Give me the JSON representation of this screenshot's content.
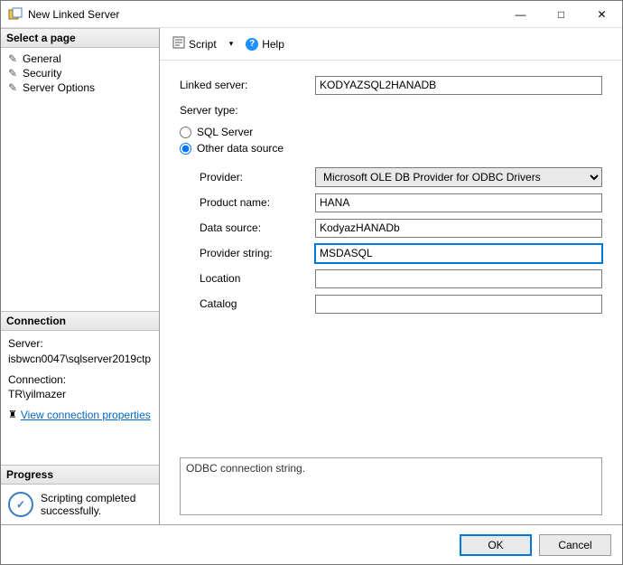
{
  "window": {
    "title": "New Linked Server"
  },
  "winbuttons": {
    "min": "—",
    "max": "□",
    "close": "✕"
  },
  "sidebar": {
    "select_page_hdr": "Select a page",
    "pages": [
      {
        "label": "General"
      },
      {
        "label": "Security"
      },
      {
        "label": "Server Options"
      }
    ],
    "connection_hdr": "Connection",
    "server_lbl": "Server:",
    "server_val": "isbwcn0047\\sqlserver2019ctp",
    "conn_lbl": "Connection:",
    "conn_val": "TR\\yilmazer",
    "view_conn_link": "View connection properties",
    "progress_hdr": "Progress",
    "progress_msg": "Scripting completed successfully."
  },
  "toolbar": {
    "script_label": "Script",
    "script_arrow": "▾",
    "help_label": "Help"
  },
  "form": {
    "linked_server_lbl": "Linked server:",
    "linked_server_val": "KODYAZSQL2HANADB",
    "server_type_lbl": "Server type:",
    "radio_sql": "SQL Server",
    "radio_other": "Other data source",
    "provider_lbl": "Provider:",
    "provider_val": "Microsoft OLE DB Provider for ODBC Drivers",
    "product_name_lbl": "Product name:",
    "product_name_val": "HANA",
    "data_source_lbl": "Data source:",
    "data_source_val": "KodyazHANADb",
    "provider_string_lbl": "Provider string:",
    "provider_string_val": "MSDASQL",
    "location_lbl": "Location",
    "location_val": "",
    "catalog_lbl": "Catalog",
    "catalog_val": "",
    "description": "ODBC connection string."
  },
  "footer": {
    "ok": "OK",
    "cancel": "Cancel"
  }
}
